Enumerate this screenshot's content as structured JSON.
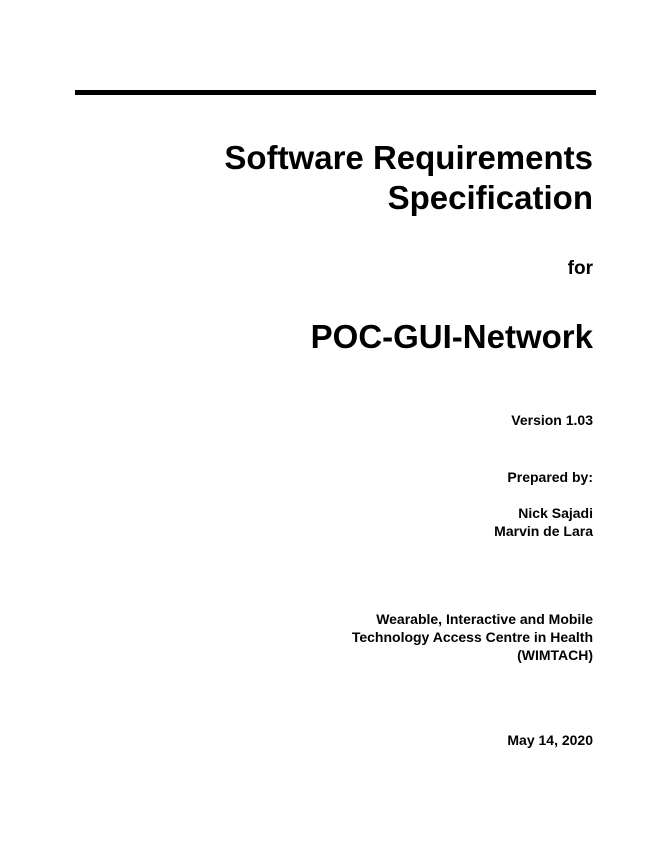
{
  "document": {
    "title_lines": [
      "Software Requirements",
      "Specification"
    ],
    "for_label": "for",
    "project_name": "POC-GUI-Network",
    "version": "Version 1.03",
    "prepared_by_label": "Prepared by:",
    "authors": [
      "Nick Sajadi",
      "Marvin de Lara"
    ],
    "organization_lines": [
      "Wearable, Interactive and Mobile",
      "Technology Access Centre in Health",
      "(WIMTACH)"
    ],
    "date": "May 14, 2020"
  }
}
